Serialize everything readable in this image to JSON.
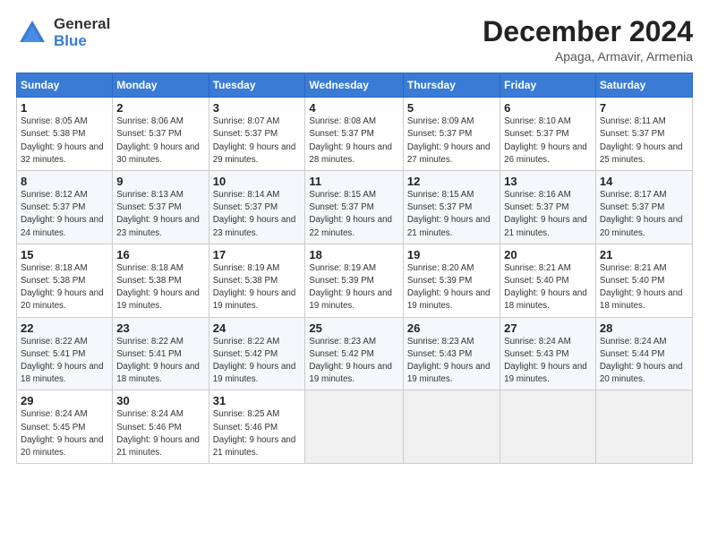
{
  "logo": {
    "general": "General",
    "blue": "Blue"
  },
  "title": "December 2024",
  "subtitle": "Apaga, Armavir, Armenia",
  "days_of_week": [
    "Sunday",
    "Monday",
    "Tuesday",
    "Wednesday",
    "Thursday",
    "Friday",
    "Saturday"
  ],
  "weeks": [
    [
      {
        "day": "1",
        "sunrise": "8:05 AM",
        "sunset": "5:38 PM",
        "daylight": "9 hours and 32 minutes."
      },
      {
        "day": "2",
        "sunrise": "8:06 AM",
        "sunset": "5:37 PM",
        "daylight": "9 hours and 30 minutes."
      },
      {
        "day": "3",
        "sunrise": "8:07 AM",
        "sunset": "5:37 PM",
        "daylight": "9 hours and 29 minutes."
      },
      {
        "day": "4",
        "sunrise": "8:08 AM",
        "sunset": "5:37 PM",
        "daylight": "9 hours and 28 minutes."
      },
      {
        "day": "5",
        "sunrise": "8:09 AM",
        "sunset": "5:37 PM",
        "daylight": "9 hours and 27 minutes."
      },
      {
        "day": "6",
        "sunrise": "8:10 AM",
        "sunset": "5:37 PM",
        "daylight": "9 hours and 26 minutes."
      },
      {
        "day": "7",
        "sunrise": "8:11 AM",
        "sunset": "5:37 PM",
        "daylight": "9 hours and 25 minutes."
      }
    ],
    [
      {
        "day": "8",
        "sunrise": "8:12 AM",
        "sunset": "5:37 PM",
        "daylight": "9 hours and 24 minutes."
      },
      {
        "day": "9",
        "sunrise": "8:13 AM",
        "sunset": "5:37 PM",
        "daylight": "9 hours and 23 minutes."
      },
      {
        "day": "10",
        "sunrise": "8:14 AM",
        "sunset": "5:37 PM",
        "daylight": "9 hours and 23 minutes."
      },
      {
        "day": "11",
        "sunrise": "8:15 AM",
        "sunset": "5:37 PM",
        "daylight": "9 hours and 22 minutes."
      },
      {
        "day": "12",
        "sunrise": "8:15 AM",
        "sunset": "5:37 PM",
        "daylight": "9 hours and 21 minutes."
      },
      {
        "day": "13",
        "sunrise": "8:16 AM",
        "sunset": "5:37 PM",
        "daylight": "9 hours and 21 minutes."
      },
      {
        "day": "14",
        "sunrise": "8:17 AM",
        "sunset": "5:37 PM",
        "daylight": "9 hours and 20 minutes."
      }
    ],
    [
      {
        "day": "15",
        "sunrise": "8:18 AM",
        "sunset": "5:38 PM",
        "daylight": "9 hours and 20 minutes."
      },
      {
        "day": "16",
        "sunrise": "8:18 AM",
        "sunset": "5:38 PM",
        "daylight": "9 hours and 19 minutes."
      },
      {
        "day": "17",
        "sunrise": "8:19 AM",
        "sunset": "5:38 PM",
        "daylight": "9 hours and 19 minutes."
      },
      {
        "day": "18",
        "sunrise": "8:19 AM",
        "sunset": "5:39 PM",
        "daylight": "9 hours and 19 minutes."
      },
      {
        "day": "19",
        "sunrise": "8:20 AM",
        "sunset": "5:39 PM",
        "daylight": "9 hours and 19 minutes."
      },
      {
        "day": "20",
        "sunrise": "8:21 AM",
        "sunset": "5:40 PM",
        "daylight": "9 hours and 18 minutes."
      },
      {
        "day": "21",
        "sunrise": "8:21 AM",
        "sunset": "5:40 PM",
        "daylight": "9 hours and 18 minutes."
      }
    ],
    [
      {
        "day": "22",
        "sunrise": "8:22 AM",
        "sunset": "5:41 PM",
        "daylight": "9 hours and 18 minutes."
      },
      {
        "day": "23",
        "sunrise": "8:22 AM",
        "sunset": "5:41 PM",
        "daylight": "9 hours and 18 minutes."
      },
      {
        "day": "24",
        "sunrise": "8:22 AM",
        "sunset": "5:42 PM",
        "daylight": "9 hours and 19 minutes."
      },
      {
        "day": "25",
        "sunrise": "8:23 AM",
        "sunset": "5:42 PM",
        "daylight": "9 hours and 19 minutes."
      },
      {
        "day": "26",
        "sunrise": "8:23 AM",
        "sunset": "5:43 PM",
        "daylight": "9 hours and 19 minutes."
      },
      {
        "day": "27",
        "sunrise": "8:24 AM",
        "sunset": "5:43 PM",
        "daylight": "9 hours and 19 minutes."
      },
      {
        "day": "28",
        "sunrise": "8:24 AM",
        "sunset": "5:44 PM",
        "daylight": "9 hours and 20 minutes."
      }
    ],
    [
      {
        "day": "29",
        "sunrise": "8:24 AM",
        "sunset": "5:45 PM",
        "daylight": "9 hours and 20 minutes."
      },
      {
        "day": "30",
        "sunrise": "8:24 AM",
        "sunset": "5:46 PM",
        "daylight": "9 hours and 21 minutes."
      },
      {
        "day": "31",
        "sunrise": "8:25 AM",
        "sunset": "5:46 PM",
        "daylight": "9 hours and 21 minutes."
      },
      null,
      null,
      null,
      null
    ]
  ]
}
